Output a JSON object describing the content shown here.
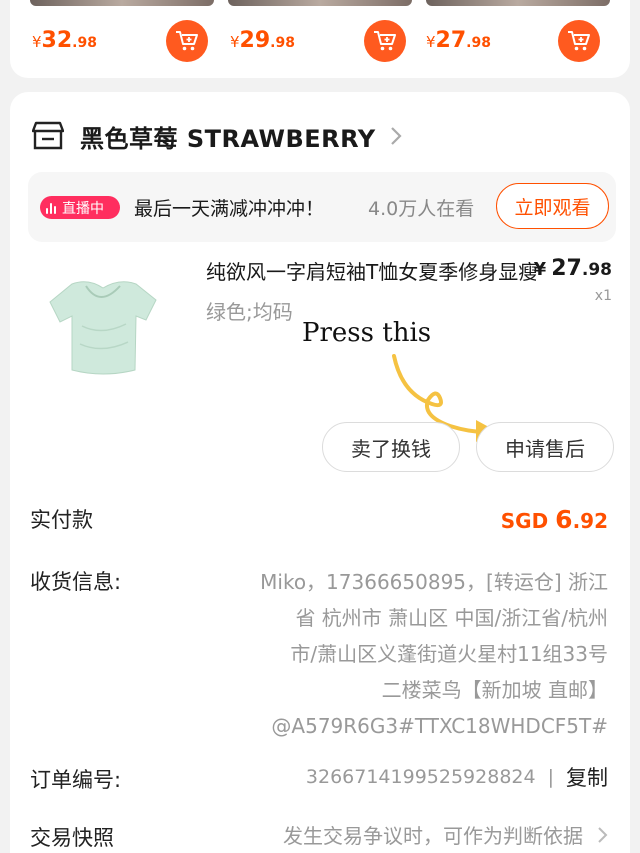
{
  "recommendations": [
    {
      "currency": "¥",
      "integer": "32",
      "decimal": ".98"
    },
    {
      "currency": "¥",
      "integer": "29",
      "decimal": ".98"
    },
    {
      "currency": "¥",
      "integer": "27",
      "decimal": ".98"
    }
  ],
  "shop": {
    "name": "黑色草莓 STRAWBERRY"
  },
  "live": {
    "badge": "直播中",
    "text": "最后一天满减冲冲冲！",
    "viewers": "4.0万人在看",
    "watch_label": "立即观看"
  },
  "product": {
    "title": "纯欲风一字肩短袖T恤女夏季修身显瘦",
    "variant": "绿色;均码",
    "price_currency": "¥",
    "price_integer": "27",
    "price_decimal": ".98",
    "quantity": "x1"
  },
  "annotation": {
    "text": "Press this"
  },
  "actions": {
    "resell_label": "卖了换钱",
    "after_sale_label": "申请售后"
  },
  "paid": {
    "label": "实付款",
    "currency": "SGD ",
    "integer": "6",
    "decimal": ".92"
  },
  "shipping": {
    "label": "收货信息:",
    "lines": [
      "Miko，17366650895，[转运仓] 浙江",
      "省 杭州市 萧山区 中国/浙江省/杭州",
      "市/萧山区义蓬街道火星村11组33号",
      "二楼菜鸟【新加坡 直邮】",
      "@A579R6G3#TTXC18WHDCF5T#"
    ]
  },
  "order": {
    "label": "订单编号:",
    "number": "3266714199525928824",
    "separator": "|",
    "copy_label": "复制"
  },
  "snapshot": {
    "label": "交易快照",
    "value": "发生交易争议时，可作为判断依据"
  },
  "colors": {
    "accent": "#ff5000",
    "live": "#ff2e5f",
    "annotation": "#f5c242"
  }
}
